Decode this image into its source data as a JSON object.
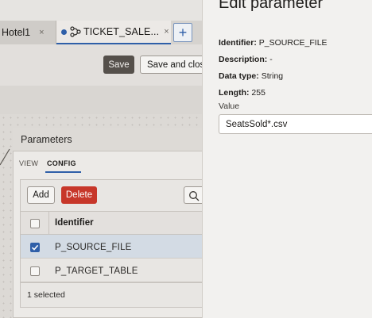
{
  "tabs": [
    {
      "label": "Hotel1",
      "close": "×"
    },
    {
      "label": "TICKET_SALE...",
      "close": "×",
      "active": true
    }
  ],
  "add_tab_symbol": "+",
  "toolbar": {
    "save_label": "Save",
    "save_close_label": "Save and close"
  },
  "parameters_panel": {
    "title": "Parameters",
    "tabs": [
      "VIEW",
      "CONFIG"
    ],
    "active_tab": "CONFIG",
    "add_label": "Add",
    "delete_label": "Delete",
    "column_identifier": "Identifier",
    "rows": [
      {
        "identifier": "P_SOURCE_FILE",
        "selected": true
      },
      {
        "identifier": "P_TARGET_TABLE",
        "selected": false
      }
    ],
    "status": "1 selected"
  },
  "drawer": {
    "title": "Edit parameter",
    "identifier_label": "Identifier:",
    "identifier_value": "P_SOURCE_FILE",
    "description_label": "Description:",
    "description_value": "-",
    "datatype_label": "Data type:",
    "datatype_value": "String",
    "length_label": "Length:",
    "length_value": "255",
    "value_label": "Value",
    "value": "SeatsSold*.csv"
  },
  "colors": {
    "accent": "#2f5fa8",
    "delete": "#c7372a",
    "save_dark": "#55504b"
  }
}
